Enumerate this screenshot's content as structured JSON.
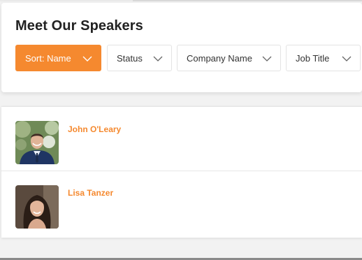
{
  "header": {
    "title": "Meet Our Speakers"
  },
  "filters": {
    "sort_label": "Sort: Name",
    "status_label": "Status",
    "company_label": "Company Name",
    "job_label": "Job Title"
  },
  "speakers": [
    {
      "name": "John O'Leary",
      "avatar": "speaker-photo-john"
    },
    {
      "name": "Lisa Tanzer",
      "avatar": "speaker-photo-lisa"
    }
  ],
  "colors": {
    "accent": "#f5892f",
    "background": "#f2f2f2",
    "card": "#ffffff"
  }
}
